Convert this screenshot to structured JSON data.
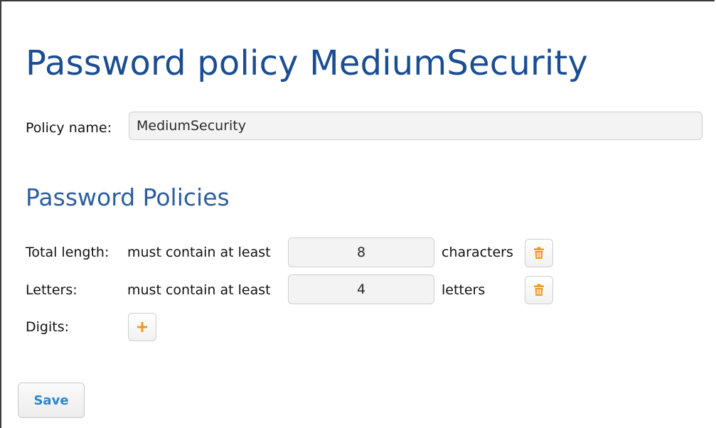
{
  "page": {
    "title": "Password policy MediumSecurity"
  },
  "policy_name": {
    "label": "Policy name:",
    "value": "MediumSecurity"
  },
  "section": {
    "title": "Password Policies"
  },
  "rules": [
    {
      "label": "Total length:",
      "prefix": "must contain at least",
      "value": "8",
      "suffix": "characters",
      "action_icon": "trash-icon"
    },
    {
      "label": "Letters:",
      "prefix": "must contain at least",
      "value": "4",
      "suffix": "letters",
      "action_icon": "trash-icon"
    },
    {
      "label": "Digits:",
      "action_icon": "plus-icon"
    }
  ],
  "actions": {
    "save_label": "Save"
  },
  "colors": {
    "title": "#1b4d93",
    "section_title": "#2b5e9e",
    "icon_accent": "#f09a1a",
    "save_text": "#2a86c8"
  }
}
